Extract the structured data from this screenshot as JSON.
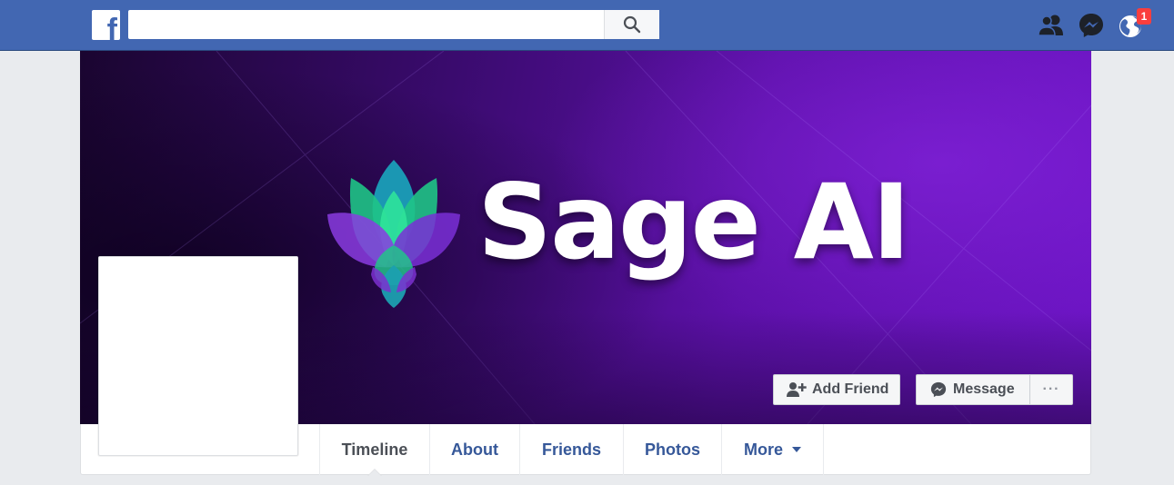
{
  "topbar": {
    "logo_letter": "f",
    "search_placeholder": "",
    "search_icon": "search-icon",
    "icons": [
      "friend-requests-icon",
      "messenger-icon",
      "notifications-globe-icon"
    ],
    "notifications_count": "1",
    "colors": {
      "bar": "#4267b2",
      "badge": "#fa3e3e"
    }
  },
  "cover": {
    "brand_text": "Sage AI",
    "logo": "lotus-logo",
    "buttons": {
      "add_friend": "Add Friend",
      "message": "Message",
      "more": "···"
    },
    "colors": {
      "purple": "#5c10a8",
      "teal": "#1aa0a0",
      "green": "#1fd68f",
      "violet": "#8a3ce0"
    }
  },
  "tabs": [
    {
      "label": "Timeline",
      "active": true
    },
    {
      "label": "About"
    },
    {
      "label": "Friends"
    },
    {
      "label": "Photos"
    },
    {
      "label": "More"
    }
  ]
}
